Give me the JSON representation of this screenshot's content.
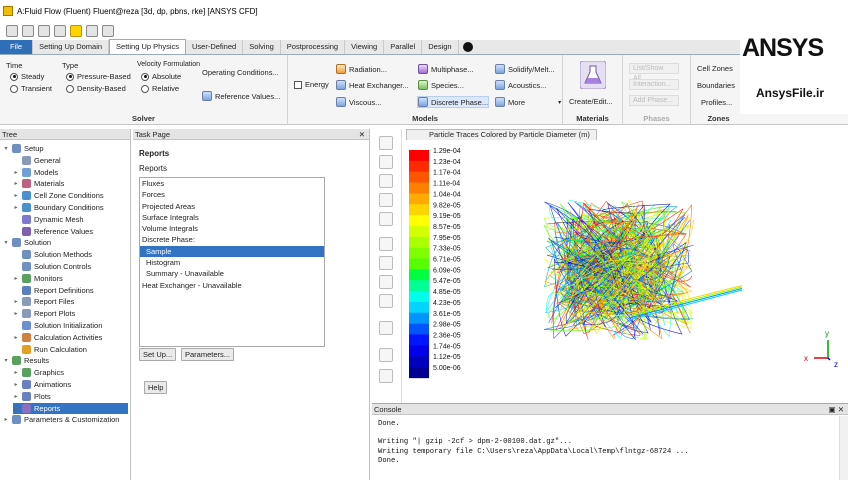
{
  "window": {
    "title": "A:Fluid Flow (Fluent) Fluent@reza [3d, dp, pbns, rke] [ANSYS CFD]"
  },
  "tabs": [
    "File",
    "Setting Up Domain",
    "Setting Up Physics",
    "User-Defined",
    "Solving",
    "Postprocessing",
    "Viewing",
    "Parallel",
    "Design"
  ],
  "solver": {
    "title": "Solver",
    "time_label": "Time",
    "time_options": [
      "Steady",
      "Transient"
    ],
    "type_label": "Type",
    "type_options": [
      "Pressure-Based",
      "Density-Based"
    ],
    "velocity_label": "Velocity Formulation",
    "velocity_options": [
      "Absolute",
      "Relative"
    ],
    "operating_conditions": "Operating Conditions...",
    "reference_values": "Reference Values..."
  },
  "models": {
    "title": "Models",
    "energy": "Energy",
    "radiation": "Radiation...",
    "heat_exchanger": "Heat Exchanger...",
    "viscous": "Viscous...",
    "multiphase": "Multiphase...",
    "species": "Species...",
    "discrete_phase": "Discrete Phase...",
    "solidify": "Solidify/Melt...",
    "acoustics": "Acoustics...",
    "more": "More"
  },
  "materials": {
    "title": "Materials",
    "create": "Create/Edit..."
  },
  "phases": {
    "title": "Phases",
    "items": [
      "List/Show All...",
      "Interaction...",
      "Add Phase..."
    ]
  },
  "zones": {
    "title": "Zones",
    "cell_zones": "Cell Zones",
    "boundaries": "Boundaries",
    "profiles": "Profiles..."
  },
  "logo": {
    "brand": "ANSYS",
    "site": "AnsysFile.ir"
  },
  "tree": {
    "header": "Tree",
    "nodes": [
      {
        "label": "Setup",
        "level": 0,
        "twist": "▾",
        "color": "#6f8ec4"
      },
      {
        "label": "General",
        "level": 1,
        "twist": "",
        "color": "#8899bb"
      },
      {
        "label": "Models",
        "level": 1,
        "twist": "▸",
        "color": "#6fa0d8"
      },
      {
        "label": "Materials",
        "level": 1,
        "twist": "▸",
        "color": "#c06080"
      },
      {
        "label": "Cell Zone Conditions",
        "level": 1,
        "twist": "▸",
        "color": "#4a90d0"
      },
      {
        "label": "Boundary Conditions",
        "level": 1,
        "twist": "▸",
        "color": "#4a90d0"
      },
      {
        "label": "Dynamic Mesh",
        "level": 1,
        "twist": "",
        "color": "#7a7ad0"
      },
      {
        "label": "Reference Values",
        "level": 1,
        "twist": "",
        "color": "#8060b0"
      },
      {
        "label": "Solution",
        "level": 0,
        "twist": "▾",
        "color": "#6f8ec4"
      },
      {
        "label": "Solution Methods",
        "level": 1,
        "twist": "",
        "color": "#7090c0"
      },
      {
        "label": "Solution Controls",
        "level": 1,
        "twist": "",
        "color": "#7090c0"
      },
      {
        "label": "Monitors",
        "level": 1,
        "twist": "▸",
        "color": "#5aa060"
      },
      {
        "label": "Report Definitions",
        "level": 1,
        "twist": "",
        "color": "#5a80c0"
      },
      {
        "label": "Report Files",
        "level": 1,
        "twist": "▸",
        "color": "#8899bb"
      },
      {
        "label": "Report Plots",
        "level": 1,
        "twist": "▸",
        "color": "#8899bb"
      },
      {
        "label": "Solution Initialization",
        "level": 1,
        "twist": "",
        "color": "#6a90d0"
      },
      {
        "label": "Calculation Activities",
        "level": 1,
        "twist": "▸",
        "color": "#d08040"
      },
      {
        "label": "Run Calculation",
        "level": 1,
        "twist": "",
        "color": "#e0a020"
      },
      {
        "label": "Results",
        "level": 0,
        "twist": "▾",
        "color": "#5aa060"
      },
      {
        "label": "Graphics",
        "level": 1,
        "twist": "▸",
        "color": "#5aa060"
      },
      {
        "label": "Animations",
        "level": 1,
        "twist": "▸",
        "color": "#6a80c0"
      },
      {
        "label": "Plots",
        "level": 1,
        "twist": "▸",
        "color": "#6a80c0"
      },
      {
        "label": "Reports",
        "level": 1,
        "twist": "▸",
        "color": "#8a70c0",
        "selected": true
      },
      {
        "label": "Parameters & Customization",
        "level": 0,
        "twist": "▸",
        "color": "#6f8ec4"
      }
    ]
  },
  "task": {
    "header": "Task Page",
    "section": "Reports",
    "list_label": "Reports",
    "items": [
      {
        "label": "Fluxes"
      },
      {
        "label": "Forces"
      },
      {
        "label": "Projected Areas"
      },
      {
        "label": "Surface Integrals"
      },
      {
        "label": "Volume Integrals"
      },
      {
        "label": "Discrete Phase:"
      },
      {
        "label": "Sample",
        "selected": true,
        "indent": true
      },
      {
        "label": "Histogram",
        "indent": true
      },
      {
        "label": "Summary - Unavailable",
        "indent": true
      },
      {
        "label": "Heat Exchanger - Unavailable"
      }
    ],
    "setup_button": "Set Up...",
    "parameters_button": "Parameters...",
    "help_button": "Help"
  },
  "viewer": {
    "tab_title": "Particle Traces Colored by Particle Diameter (m)",
    "colormap_labels": [
      "1.29e-04",
      "1.23e-04",
      "1.17e-04",
      "1.11e-04",
      "1.04e-04",
      "9.82e-05",
      "9.19e-05",
      "8.57e-05",
      "7.95e-05",
      "7.33e-05",
      "6.71e-05",
      "6.09e-05",
      "5.47e-05",
      "4.85e-05",
      "4.23e-05",
      "3.61e-05",
      "2.98e-05",
      "2.36e-05",
      "1.74e-05",
      "1.12e-05",
      "5.00e-06"
    ],
    "colors": [
      "#ff0000",
      "#ff2a00",
      "#ff5500",
      "#ff8000",
      "#ffaa00",
      "#ffd400",
      "#ffff00",
      "#d4ff00",
      "#aaff00",
      "#80ff00",
      "#55ff00",
      "#00ff40",
      "#00ff95",
      "#00ffea",
      "#00d4ff",
      "#0095ff",
      "#0055ff",
      "#0015ff",
      "#0000ea",
      "#0000c0",
      "#000095"
    ],
    "axes": [
      "x",
      "y",
      "z"
    ]
  },
  "console": {
    "header": "Console",
    "lines": [
      "Done.",
      "",
      "Writing \"| gzip -2cf > dpm-2-00100.dat.gz\"...",
      "Writing temporary file C:\\Users\\reza\\AppData\\Local\\Temp\\flntgz-68724 ...",
      "Done."
    ]
  }
}
